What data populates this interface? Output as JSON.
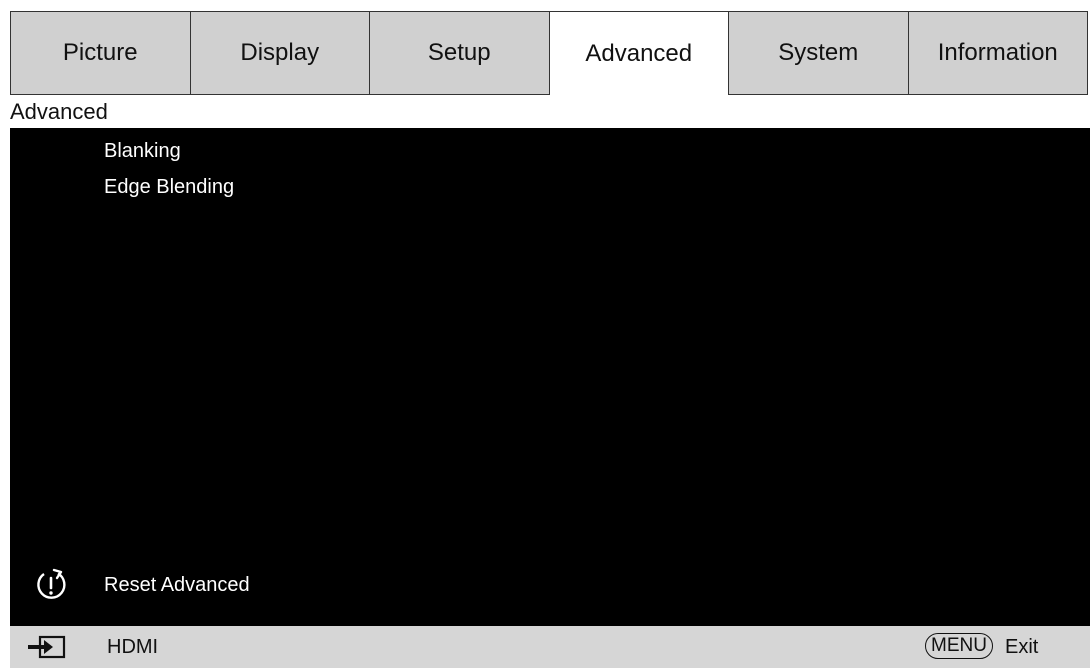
{
  "tabs": [
    {
      "label": "Picture",
      "active": false
    },
    {
      "label": "Display",
      "active": false
    },
    {
      "label": "Setup",
      "active": false
    },
    {
      "label": "Advanced",
      "active": true
    },
    {
      "label": "System",
      "active": false
    },
    {
      "label": "Information",
      "active": false
    }
  ],
  "section": {
    "title": "Advanced"
  },
  "menu": {
    "items": [
      {
        "label": "Blanking"
      },
      {
        "label": "Edge Blending"
      }
    ],
    "reset": {
      "label": "Reset Advanced",
      "icon": "reset-icon"
    }
  },
  "status": {
    "source_icon": "input-source-icon",
    "source": "HDMI",
    "menu_key": "MENU",
    "exit": "Exit"
  },
  "colors": {
    "tab_inactive": "#d0d0d0",
    "tab_active": "#ffffff",
    "panel": "#000000",
    "statusbar": "#d6d6d6"
  }
}
